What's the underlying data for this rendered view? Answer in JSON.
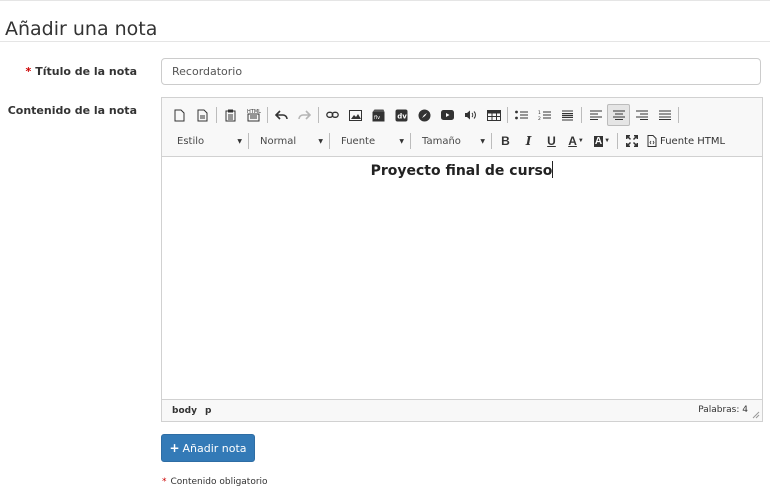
{
  "page": {
    "title": "Añadir una nota"
  },
  "form": {
    "required_mark": "*",
    "title_label": "Título de la nota",
    "title_value": "Recordatorio",
    "content_label": "Contenido de la nota",
    "submit_label": "Añadir nota",
    "required_note_mark": "*",
    "required_note": "Contenido obligatorio"
  },
  "editor": {
    "toolbar": {
      "style_combo": "Estilo",
      "format_combo": "Normal",
      "font_combo": "Fuente",
      "size_combo": "Tamaño",
      "bold": "B",
      "italic": "I",
      "underline": "U",
      "text_color": "A",
      "bg_color": "A",
      "source_label": "Fuente HTML",
      "active_button": "align-center"
    },
    "content": "Proyecto final de curso",
    "footer": {
      "path": [
        "body",
        "p"
      ],
      "word_count": "Palabras: 4"
    }
  },
  "colors": {
    "primary": "#337ab7",
    "required": "#cc0000",
    "toolbar_bg": "#f8f8f8",
    "border": "#d1d1d1"
  }
}
